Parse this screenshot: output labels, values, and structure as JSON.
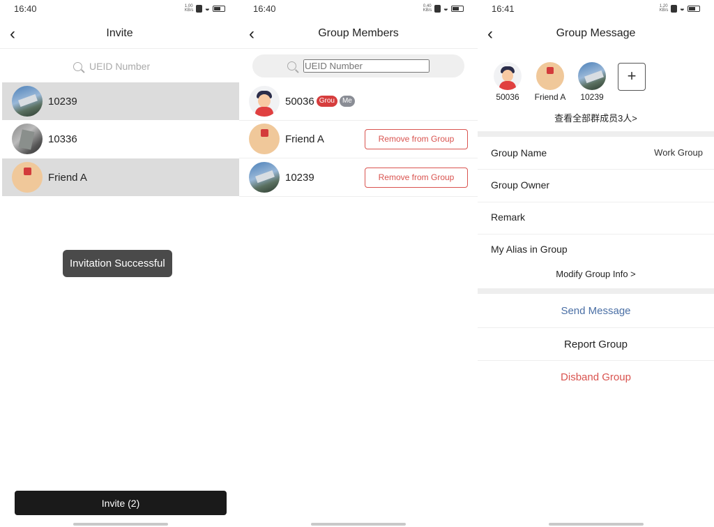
{
  "screen1": {
    "time": "16:40",
    "net_speed": "1.00 KB/s",
    "title": "Invite",
    "search_placeholder": "UEID Number",
    "contacts": [
      {
        "name": "10239",
        "avatar": "sky-photo"
      },
      {
        "name": "10336",
        "avatar": "gray-photo"
      },
      {
        "name": "Friend A",
        "avatar": "peach-logo"
      }
    ],
    "toast": "Invitation Successful",
    "invite_button": "Invite (2)"
  },
  "screen2": {
    "time": "16:40",
    "net_speed": "0.40 KB/s",
    "title": "Group Members",
    "search_placeholder": "UEID Number",
    "members": [
      {
        "name": "50036",
        "badges": [
          "Grou",
          "Me"
        ],
        "avatar": "boy-cartoon"
      },
      {
        "name": "Friend A",
        "action": "Remove from Group",
        "avatar": "peach-logo"
      },
      {
        "name": "10239",
        "action": "Remove from Group",
        "avatar": "sky-photo"
      }
    ]
  },
  "screen3": {
    "time": "16:41",
    "net_speed": "1.20 KB/s",
    "title": "Group Message",
    "members": [
      {
        "name": "50036",
        "avatar": "boy-cartoon"
      },
      {
        "name": "Friend A",
        "avatar": "peach-logo"
      },
      {
        "name": "10239",
        "avatar": "sky-photo"
      }
    ],
    "add_label": "+",
    "view_all": "查看全部群成员3人>",
    "info": [
      {
        "label": "Group Name",
        "value": "Work Group"
      },
      {
        "label": "Group Owner",
        "value": ""
      },
      {
        "label": "Remark",
        "value": ""
      },
      {
        "label": "My Alias in Group",
        "value": ""
      }
    ],
    "modify": "Modify Group Info >",
    "actions": [
      {
        "label": "Send Message",
        "color": "#4a6fa5"
      },
      {
        "label": "Report Group",
        "color": "#222222"
      },
      {
        "label": "Disband Group",
        "color": "#d9534f"
      }
    ]
  },
  "icons": {
    "back": "chevron-left-icon",
    "search": "magnifier-icon",
    "wifi": "wifi-icon",
    "battery": "battery-icon"
  },
  "colors": {
    "accent_red": "#d9534f",
    "link_blue": "#4a6fa5",
    "dark_button": "#1a1a1a"
  }
}
